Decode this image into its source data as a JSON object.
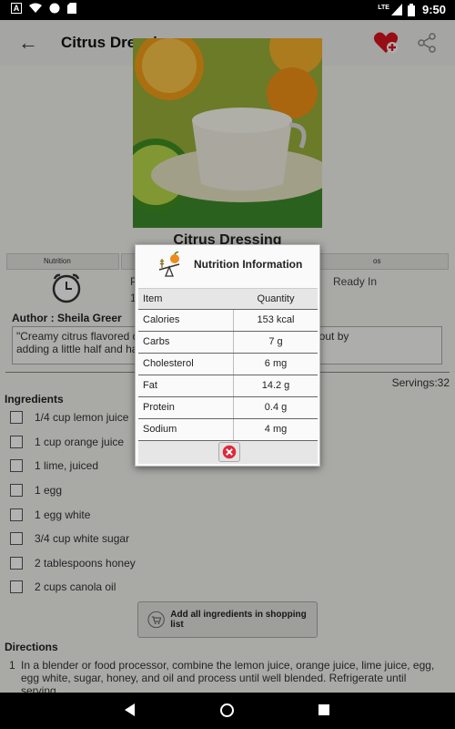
{
  "status_bar": {
    "time": "9:50",
    "lte": "LTE",
    "left_badge": "A"
  },
  "toolbar": {
    "title": "Citrus Dressing"
  },
  "recipe": {
    "name": "Citrus Dressing",
    "tabs": [
      {
        "label": "Nutrition"
      },
      {
        "label": ""
      },
      {
        "label": "os"
      }
    ],
    "stats": {
      "prep_fragment": "P",
      "prep_fragment_2": "1",
      "ready_label": "Ready In"
    },
    "author": "Author : Sheila Greer",
    "description": "\"Creamy citrus flavored d... too thick, thin it out by adding a little half and ha",
    "desc_line1_left": "\"Creamy citrus flavored d",
    "desc_line1_right": "too thick, thin it out by",
    "desc_line2": "adding a little half and ha",
    "servings": "Servings:32",
    "ingredients_heading": "Ingredients",
    "ingredients": [
      "1/4 cup lemon juice",
      "1 cup orange juice",
      "1 lime, juiced",
      "1 egg",
      "1 egg white",
      "3/4 cup white sugar",
      "2 tablespoons honey",
      "2 cups canola oil"
    ],
    "add_all_label": "Add all ingredients in shopping list",
    "directions_heading": "Directions",
    "directions": [
      {
        "num": "1",
        "text": "In a blender or food processor, combine the lemon juice, orange juice, lime juice, egg, egg white, sugar, honey, and oil and process until well blended.  Refrigerate until serving."
      }
    ]
  },
  "dialog": {
    "title": "Nutrition Information",
    "columns": {
      "item": "Item",
      "quantity": "Quantity"
    },
    "rows": [
      {
        "item": "Calories",
        "quantity": "153 kcal"
      },
      {
        "item": "Carbs",
        "quantity": "7 g"
      },
      {
        "item": "Cholesterol",
        "quantity": "6 mg"
      },
      {
        "item": "Fat",
        "quantity": "14.2 g"
      },
      {
        "item": "Protein",
        "quantity": "0.4 g"
      },
      {
        "item": "Sodium",
        "quantity": "4 mg"
      }
    ]
  },
  "colors": {
    "close_red": "#e0283a",
    "heart_red": "#d8141e",
    "accent_orange": "#f08a1a"
  }
}
